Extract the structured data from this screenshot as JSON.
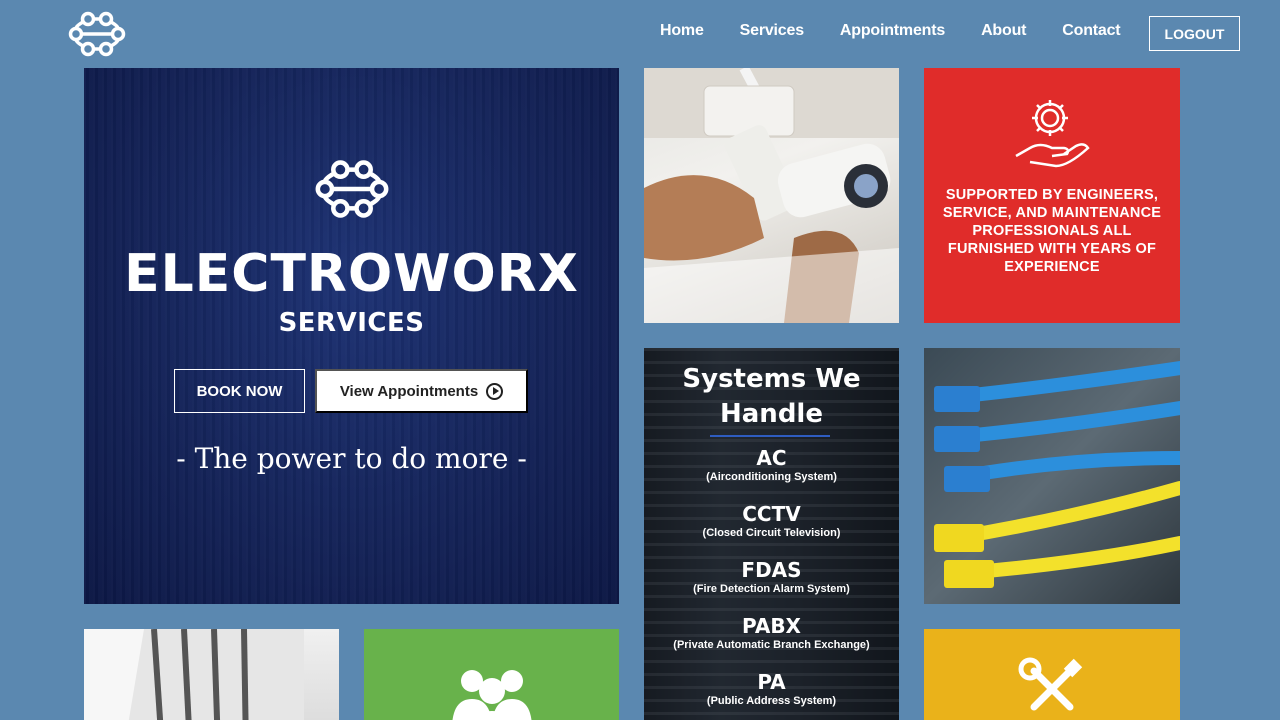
{
  "nav": {
    "items": [
      "Home",
      "Services",
      "Appointments",
      "About",
      "Contact"
    ],
    "logout_label": "LOGOUT"
  },
  "hero": {
    "brand": "ELECTROWORX",
    "sub": "SERVICES",
    "book_label": "BOOK NOW",
    "view_label": "View Appointments",
    "tagline": "- The power to do more -"
  },
  "support": {
    "text": "SUPPORTED BY ENGINEERS, SERVICE, AND MAINTENANCE PROFESSIONALS ALL FURNISHED WITH YEARS OF EXPERIENCE",
    "icon": "gear-hand-icon"
  },
  "systems": {
    "title": "Systems We Handle",
    "items": [
      {
        "abbr": "AC",
        "full": "(Airconditioning System)"
      },
      {
        "abbr": "CCTV",
        "full": "(Closed Circuit Television)"
      },
      {
        "abbr": "FDAS",
        "full": "(Fire Detection Alarm System)"
      },
      {
        "abbr": "PABX",
        "full": "(Private Automatic Branch Exchange)"
      },
      {
        "abbr": "PA",
        "full": "(Public Address System)"
      }
    ]
  },
  "colors": {
    "background": "#5b88b0",
    "red_tile": "#e02c2a",
    "green_tile": "#68b24b",
    "yellow_tile": "#eab21a",
    "hero_navy": "#142358"
  }
}
